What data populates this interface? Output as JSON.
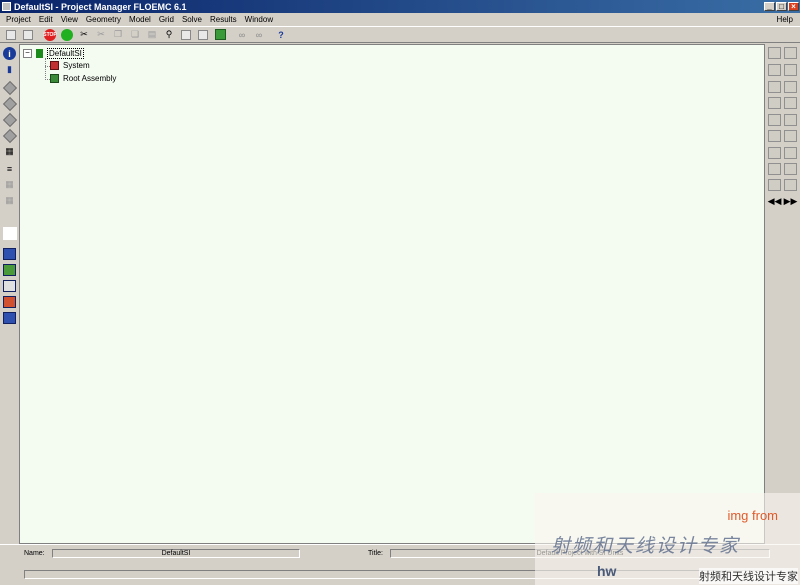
{
  "window": {
    "title": "DefaultSI - Project Manager FLOEMC 6.1"
  },
  "menu": [
    "Project",
    "Edit",
    "View",
    "Geometry",
    "Model",
    "Grid",
    "Solve",
    "Results",
    "Window"
  ],
  "menu_help": "Help",
  "toolbar": {
    "stop_label": "STOP"
  },
  "left_toolbar": {
    "info_label": "i"
  },
  "tree": {
    "root": "DefaultSI",
    "expander": "−",
    "children": [
      "System",
      "Root Assembly"
    ]
  },
  "status": {
    "name_label": "Name:",
    "name_value": "DefaultSI",
    "title_label": "Title:",
    "title_value": "Default Project with SI Units"
  },
  "watermark": {
    "img_from": "img from",
    "cn_top": "射频和天线设计专家",
    "url": "hw",
    "cn_bottom": "射频和天线设计专家"
  }
}
